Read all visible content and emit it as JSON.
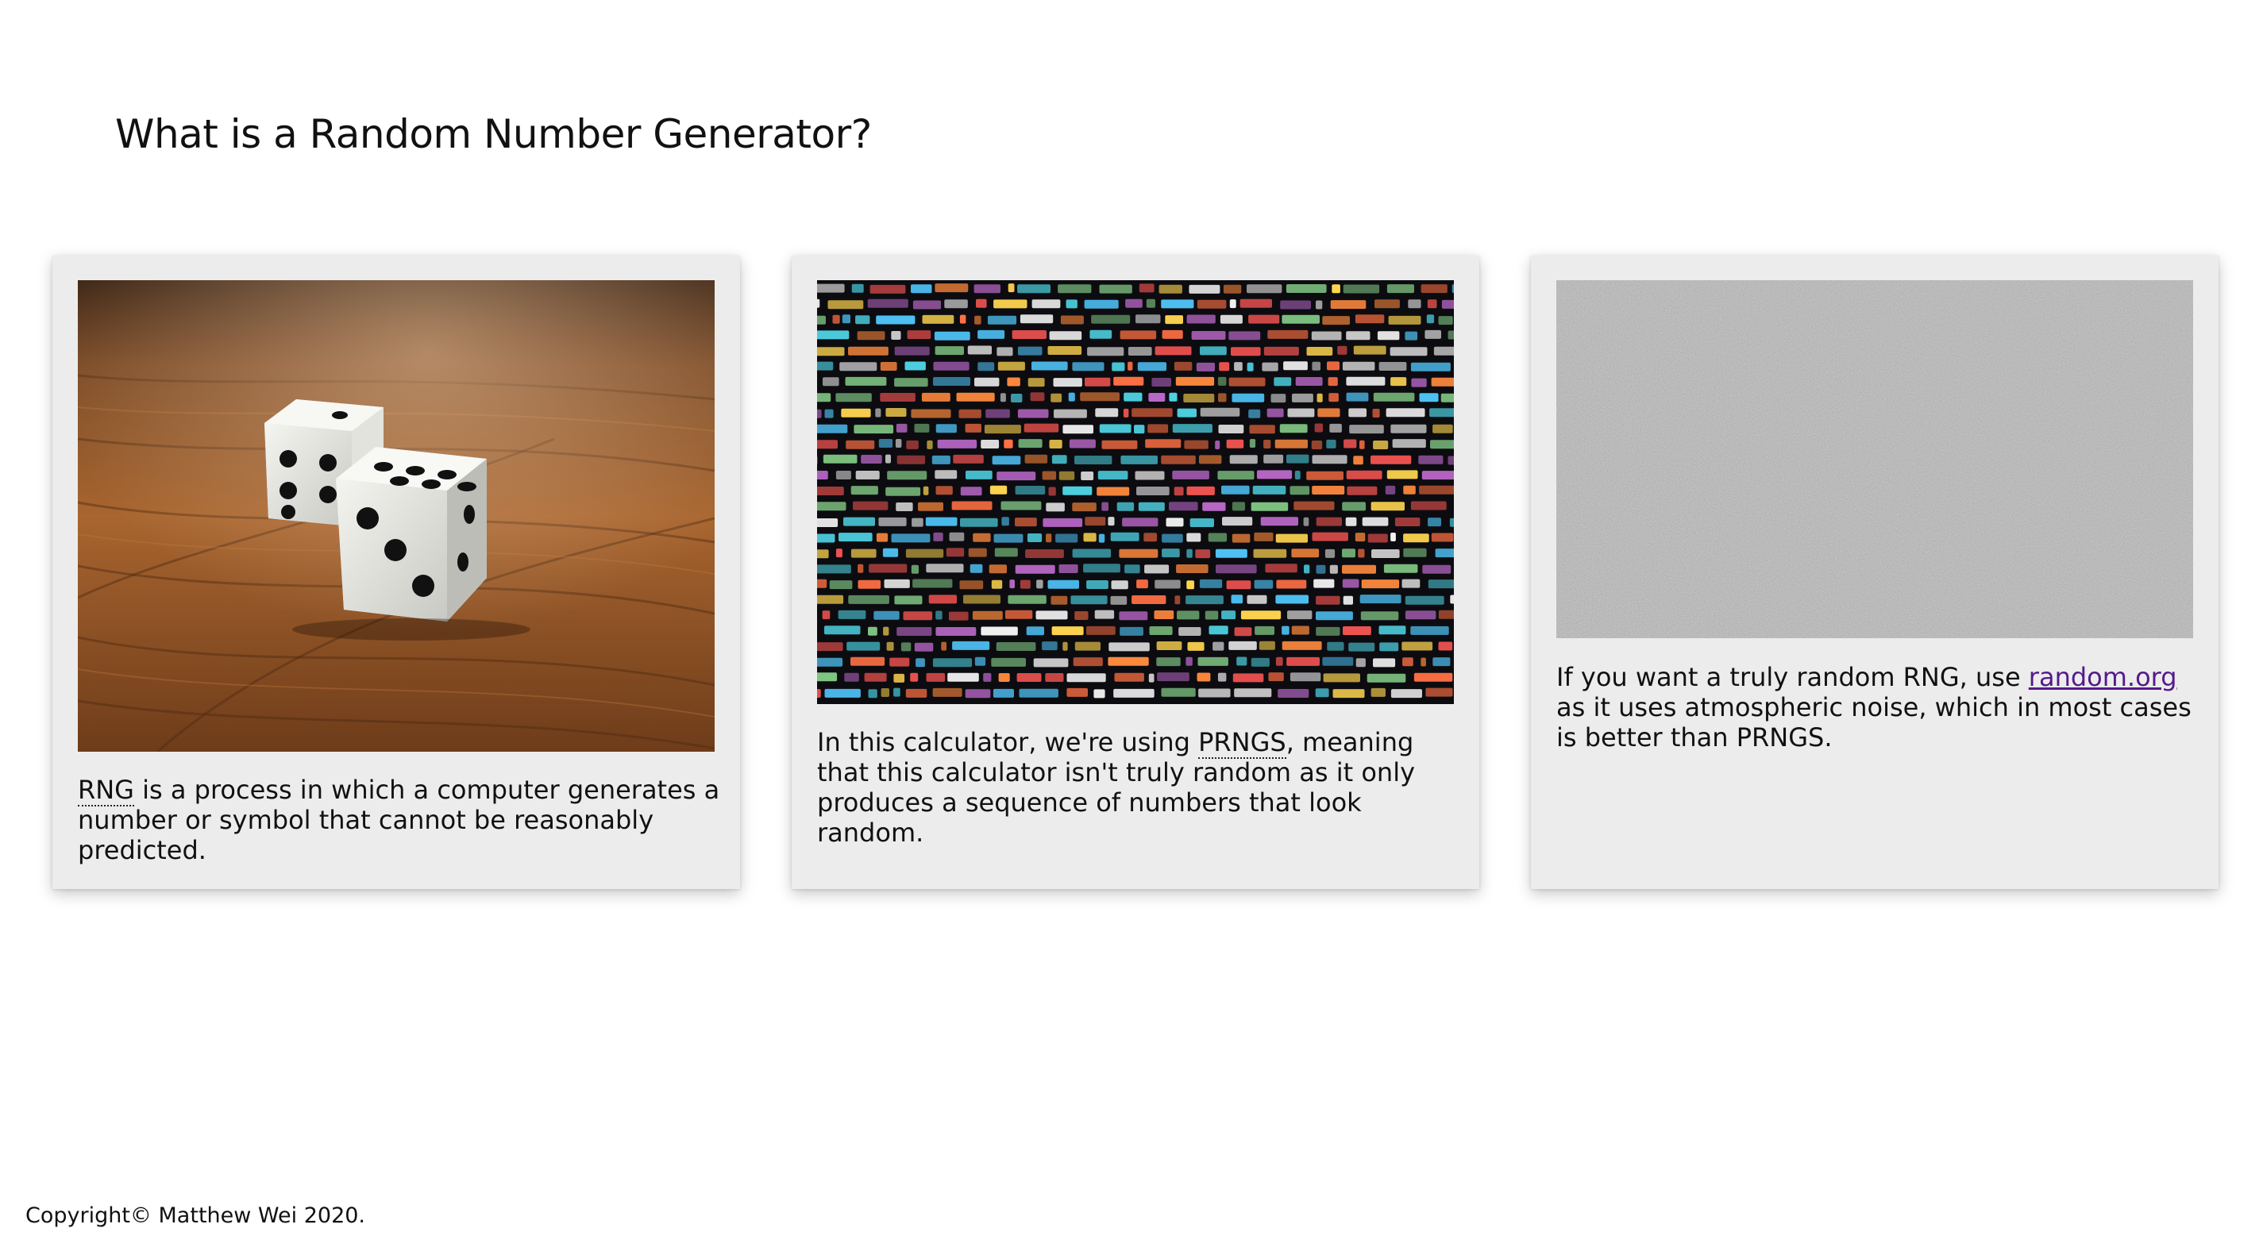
{
  "page": {
    "title": "What is a Random Number Generator?"
  },
  "cards": [
    {
      "image_alt": "dice",
      "abbr": "RNG",
      "text": " is a process in which a computer generates a number or symbol that cannot be reasonably predicted."
    },
    {
      "image_alt": "code",
      "text_before": "In this calculator, we're using ",
      "abbr": "PRNGS",
      "text_after": ", meaning that this calculator isn't truly random as it only produces a sequence of numbers that look random."
    },
    {
      "image_alt": "noise",
      "text_before": "If you want a truly random RNG, use ",
      "link_label": "random.org",
      "text_after": " as it uses atmospheric noise, which in most cases is better than PRNGS."
    }
  ],
  "footer": {
    "copyright": "Copyright© Matthew Wei 2020."
  },
  "colors": {
    "card_background": "#ececec",
    "link": "#551a8b",
    "noise_gray": "#7a7a7a",
    "wood": "#9a5a2a"
  }
}
